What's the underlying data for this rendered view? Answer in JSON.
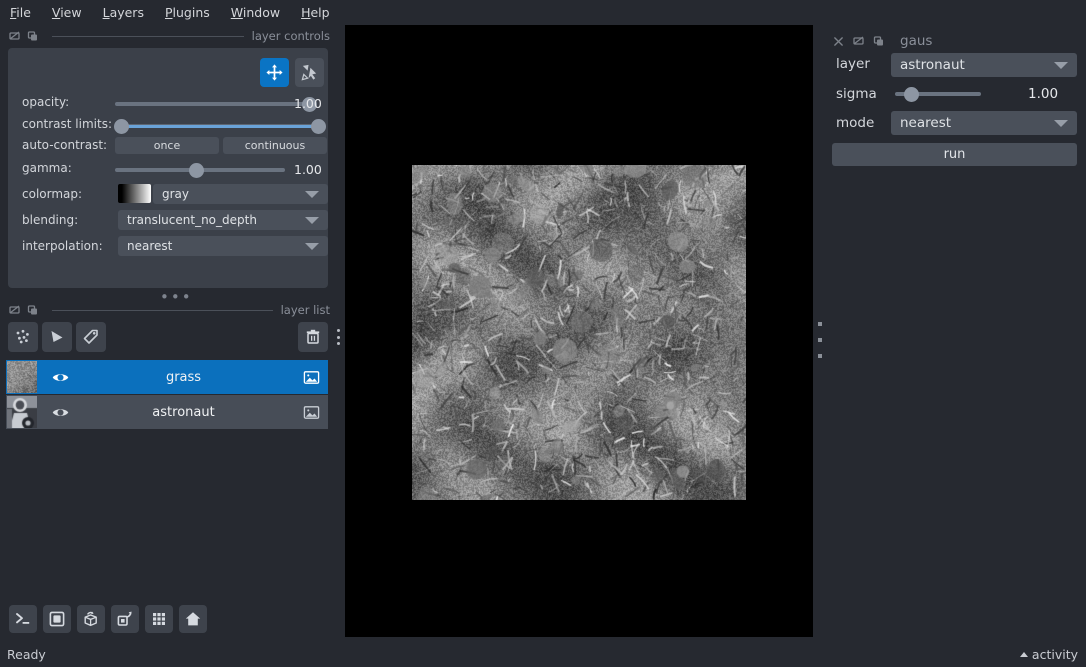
{
  "menu": {
    "items": [
      {
        "label": "File",
        "accel": "F"
      },
      {
        "label": "View",
        "accel": "V"
      },
      {
        "label": "Layers",
        "accel": "L"
      },
      {
        "label": "Plugins",
        "accel": "P"
      },
      {
        "label": "Window",
        "accel": "W"
      },
      {
        "label": "Help",
        "accel": "H"
      }
    ]
  },
  "layer_controls": {
    "dock_title": "layer controls",
    "mode_buttons": [
      {
        "name": "pan-zoom",
        "active": true
      },
      {
        "name": "transform",
        "active": false
      }
    ],
    "opacity": {
      "label": "opacity:",
      "value": "1.00",
      "fraction": 0.97
    },
    "contrast_limits": {
      "label": "contrast limits:",
      "low_fraction": 0.0,
      "high_fraction": 1.0
    },
    "auto_contrast": {
      "label": "auto-contrast:",
      "once": "once",
      "continuous": "continuous"
    },
    "gamma": {
      "label": "gamma:",
      "value": "1.00",
      "fraction": 0.37
    },
    "colormap": {
      "label": "colormap:",
      "value": "gray"
    },
    "blending": {
      "label": "blending:",
      "value": "translucent_no_depth"
    },
    "interpolation": {
      "label": "interpolation:",
      "value": "nearest"
    }
  },
  "layer_list": {
    "dock_title": "layer list",
    "tools": [
      {
        "name": "new-points-layer"
      },
      {
        "name": "new-shapes-layer"
      },
      {
        "name": "new-labels-layer"
      },
      {
        "name": "delete-layer"
      }
    ],
    "layers": [
      {
        "name": "grass",
        "selected": true,
        "visible": true,
        "type": "image"
      },
      {
        "name": "astronaut",
        "selected": false,
        "visible": true,
        "type": "image"
      }
    ]
  },
  "viewer_buttons": [
    {
      "name": "console"
    },
    {
      "name": "ndisplay-toggle"
    },
    {
      "name": "roll-dims"
    },
    {
      "name": "transpose-dims"
    },
    {
      "name": "grid-view"
    },
    {
      "name": "home"
    }
  ],
  "plugin_dock": {
    "title": "gaus",
    "layer": {
      "label": "layer",
      "value": "astronaut"
    },
    "sigma": {
      "label": "sigma",
      "value": "1.00",
      "fraction": 0.17
    },
    "mode": {
      "label": "mode",
      "value": "nearest"
    },
    "run_label": "run"
  },
  "statusbar": {
    "status": "Ready",
    "activity": "activity"
  },
  "colors": {
    "window_bg": "#262930",
    "panel_bg": "#3b4049",
    "widget_bg": "#4a505a",
    "accent_blue": "#0b70bd",
    "canvas_bg": "#000000",
    "text": "#d3d6db",
    "muted_text": "#8a8f99"
  }
}
